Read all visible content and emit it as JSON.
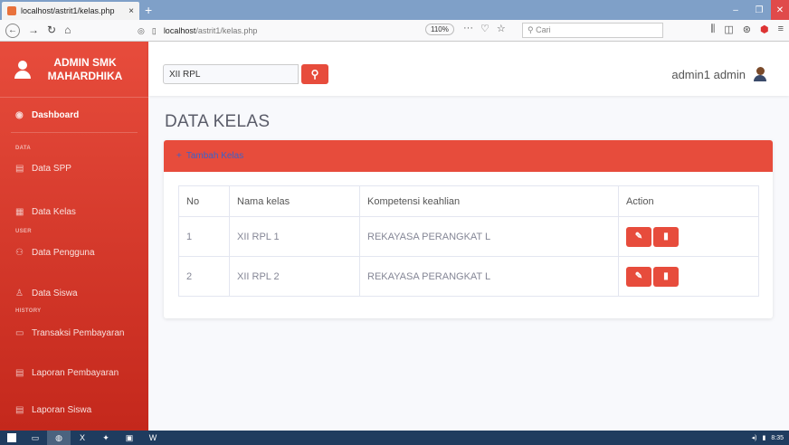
{
  "browser": {
    "tab_title": "localhost/astrit1/kelas.php",
    "tab_close": "×",
    "new_tab": "+",
    "url_host": "localhost",
    "url_path": "/astrit1/kelas.php",
    "zoom": "110%",
    "more": "···",
    "search_placeholder": "Cari"
  },
  "sidebar": {
    "brand": "ADMIN SMK MAHARDHIKA",
    "dashboard": "Dashboard",
    "heading_data": "DATA",
    "data_spp": "Data SPP",
    "data_kelas": "Data Kelas",
    "heading_user": "USER",
    "data_pengguna": "Data Pengguna",
    "data_siswa": "Data Siswa",
    "heading_history": "HISTORY",
    "transaksi": "Transaksi Pembayaran",
    "laporan_pembayaran": "Laporan Pembayaran",
    "laporan_siswa": "Laporan Siswa"
  },
  "topbar": {
    "search_value": "XII RPL",
    "user_name": "admin1 admin"
  },
  "main": {
    "page_title": "DATA KELAS",
    "add_button": "Tambah Kelas",
    "table": {
      "headers": [
        "No",
        "Nama kelas",
        "Kompetensi keahlian",
        "Action"
      ],
      "rows": [
        [
          "1",
          "XII RPL 1",
          "REKAYASA PERANGKAT L"
        ],
        [
          "2",
          "XII RPL 2",
          "REKAYASA PERANGKAT L"
        ]
      ]
    }
  },
  "taskbar": {
    "time": "8:35"
  },
  "colors": {
    "accent": "#e74c3c",
    "link": "#3d62c9"
  }
}
